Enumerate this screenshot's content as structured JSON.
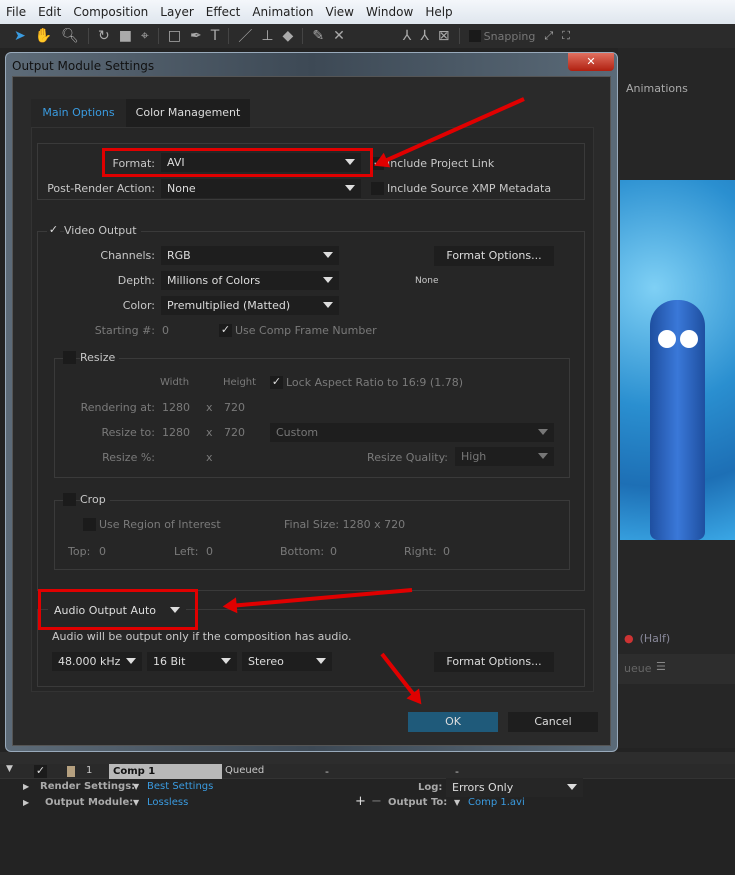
{
  "menu": [
    "File",
    "Edit",
    "Composition",
    "Layer",
    "Effect",
    "Animation",
    "View",
    "Window",
    "Help"
  ],
  "toolbar": {
    "snapping": "Snapping"
  },
  "background": {
    "animations_tab": "Animations",
    "resolution": "(Half)",
    "queue_tab": "ueue"
  },
  "dialog": {
    "title": "Output Module Settings",
    "tabs": [
      "Main Options",
      "Color Management"
    ],
    "format_label": "Format:",
    "format_value": "AVI",
    "include_project_link": "Include Project Link",
    "post_render_label": "Post-Render Action:",
    "post_render_value": "None",
    "include_xmp": "Include Source XMP Metadata",
    "video_output": "Video Output",
    "channels_label": "Channels:",
    "channels_value": "RGB",
    "depth_label": "Depth:",
    "depth_value": "Millions of Colors",
    "color_label": "Color:",
    "color_value": "Premultiplied (Matted)",
    "format_options": "Format Options...",
    "codec_none": "None",
    "starting_label": "Starting #:",
    "starting_value": "0",
    "use_comp_frame": "Use Comp Frame Number",
    "resize": "Resize",
    "width_hdr": "Width",
    "height_hdr": "Height",
    "lock_aspect": "Lock Aspect Ratio to 16:9 (1.78)",
    "rendering_at_label": "Rendering at:",
    "rendering_w": "1280",
    "rendering_h": "720",
    "x": "x",
    "resize_to_label": "Resize to:",
    "resize_w": "1280",
    "resize_h": "720",
    "resize_preset": "Custom",
    "resize_pct_label": "Resize %:",
    "resize_quality_label": "Resize Quality:",
    "resize_quality": "High",
    "crop": "Crop",
    "use_roi": "Use Region of Interest",
    "final_size": "Final Size: 1280 x 720",
    "top": "Top:",
    "top_v": "0",
    "left": "Left:",
    "left_v": "0",
    "bottom": "Bottom:",
    "bottom_v": "0",
    "right": "Right:",
    "right_v": "0",
    "audio_mode": "Audio Output Auto",
    "audio_note": "Audio will be output only if the composition has audio.",
    "sample_rate": "48.000 kHz",
    "bit_depth": "16 Bit",
    "channels_audio": "Stereo",
    "audio_format_options": "Format Options...",
    "ok": "OK",
    "cancel": "Cancel"
  },
  "queue": {
    "item_number": "1",
    "comp_name": "Comp 1",
    "status": "Queued",
    "dash1": "-",
    "dash2": "-",
    "render_settings_label": "Render Settings:",
    "render_settings_value": "Best Settings",
    "log_label": "Log:",
    "log_value": "Errors Only",
    "output_module_label": "Output Module:",
    "output_module_value": "Lossless",
    "output_to_label": "Output To:",
    "output_to_value": "Comp 1.avi"
  },
  "colors": {
    "accent": "#3a9be0",
    "ok_button": "#1f5a7a",
    "annotation": "#e00000"
  }
}
